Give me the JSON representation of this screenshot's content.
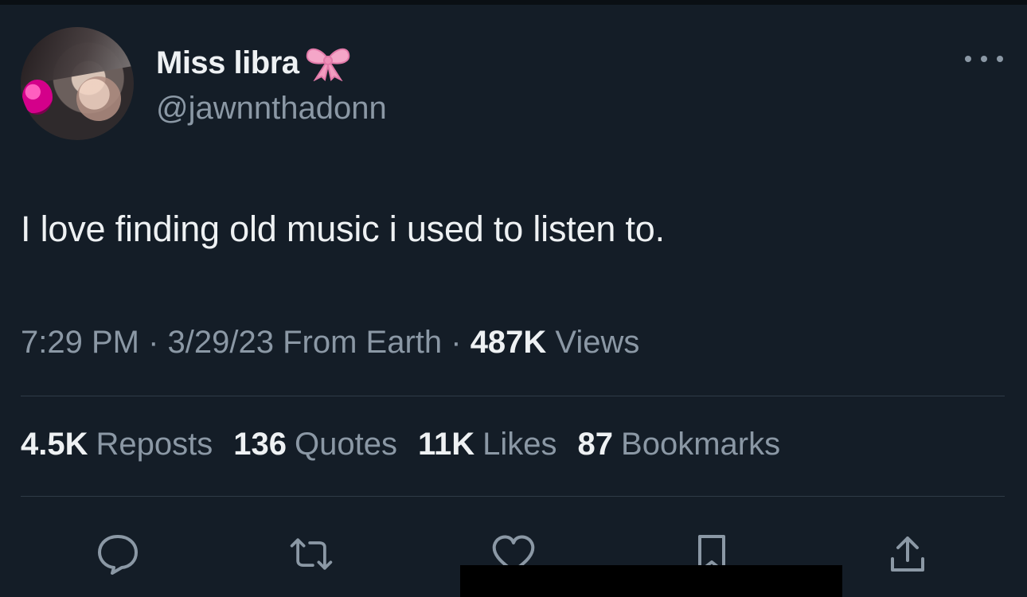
{
  "user": {
    "display_name": "Miss libra",
    "handle": "@jawnnthadonn"
  },
  "tweet": {
    "text": "I love finding old music i used to listen to.",
    "time": "7:29 PM",
    "sep1": " · ",
    "date": "3/29/23",
    "source": " From Earth",
    "sep2": " · ",
    "views_count": "487K",
    "views_label": " Views"
  },
  "stats": {
    "reposts_count": "4.5K",
    "reposts_label": "Reposts",
    "quotes_count": "136",
    "quotes_label": "Quotes",
    "likes_count": "11K",
    "likes_label": "Likes",
    "bookmarks_count": "87",
    "bookmarks_label": "Bookmarks"
  },
  "colors": {
    "background": "#141d27",
    "primary_text": "#eef1f3",
    "secondary_text": "#8b98a5",
    "divider": "#2f3b47",
    "bow_pink": "#f4a6c8"
  },
  "icons": {
    "reply": "speech-bubble-icon",
    "repost": "repost-arrows-icon",
    "like": "heart-icon",
    "bookmark": "bookmark-icon",
    "share": "share-upload-icon",
    "more": "more-dots-icon",
    "emoji": "ribbon-bow-icon"
  }
}
